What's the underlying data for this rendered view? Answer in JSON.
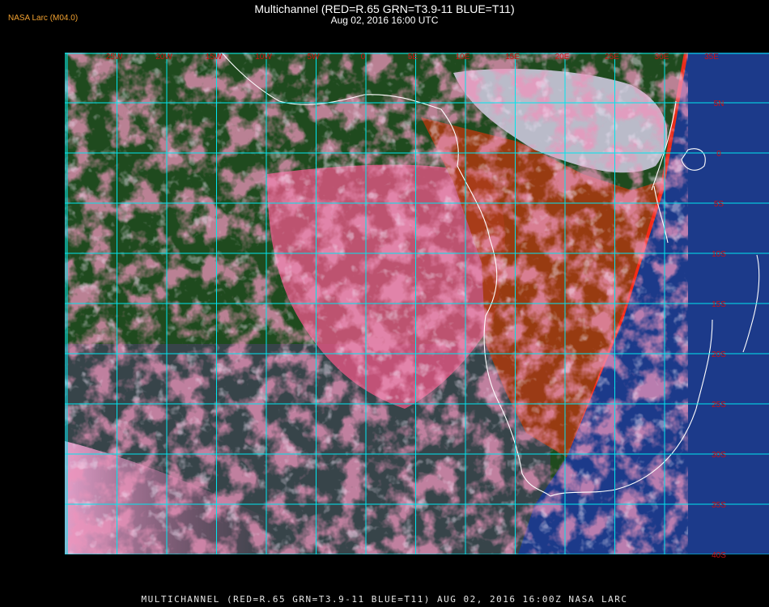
{
  "header": {
    "title": "Multichannel (RED=R.65 GRN=T3.9-11 BLUE=T11)",
    "subtitle": "Aug 02, 2016 16:00 UTC",
    "brand": "NASA Larc (M04.0)"
  },
  "map": {
    "longitude_labels": [
      "25W",
      "20W",
      "15W",
      "10W",
      "5W",
      "0",
      "5E",
      "10E",
      "15E",
      "20E",
      "25E",
      "30E",
      "35E"
    ],
    "latitude_labels": [
      "5N",
      "0",
      "5S",
      "10S",
      "15S",
      "20S",
      "25S",
      "30S",
      "35S",
      "40S"
    ],
    "grid_color": "#00e5ee",
    "label_color": "#d01010",
    "coastline_color": "#ffffff"
  },
  "footer": {
    "caption": "MULTICHANNEL (RED=R.65 GRN=T3.9-11 BLUE=T11) AUG 02, 2016 16:00Z  NASA LARC"
  },
  "colors": {
    "background": "#000000",
    "brand_text": "#f0a030",
    "ocean_green": "#1f4a1e",
    "cloud_pink": "#d9557f",
    "land_orange": "#a53a10",
    "blue_region": "#1c3a8a"
  }
}
